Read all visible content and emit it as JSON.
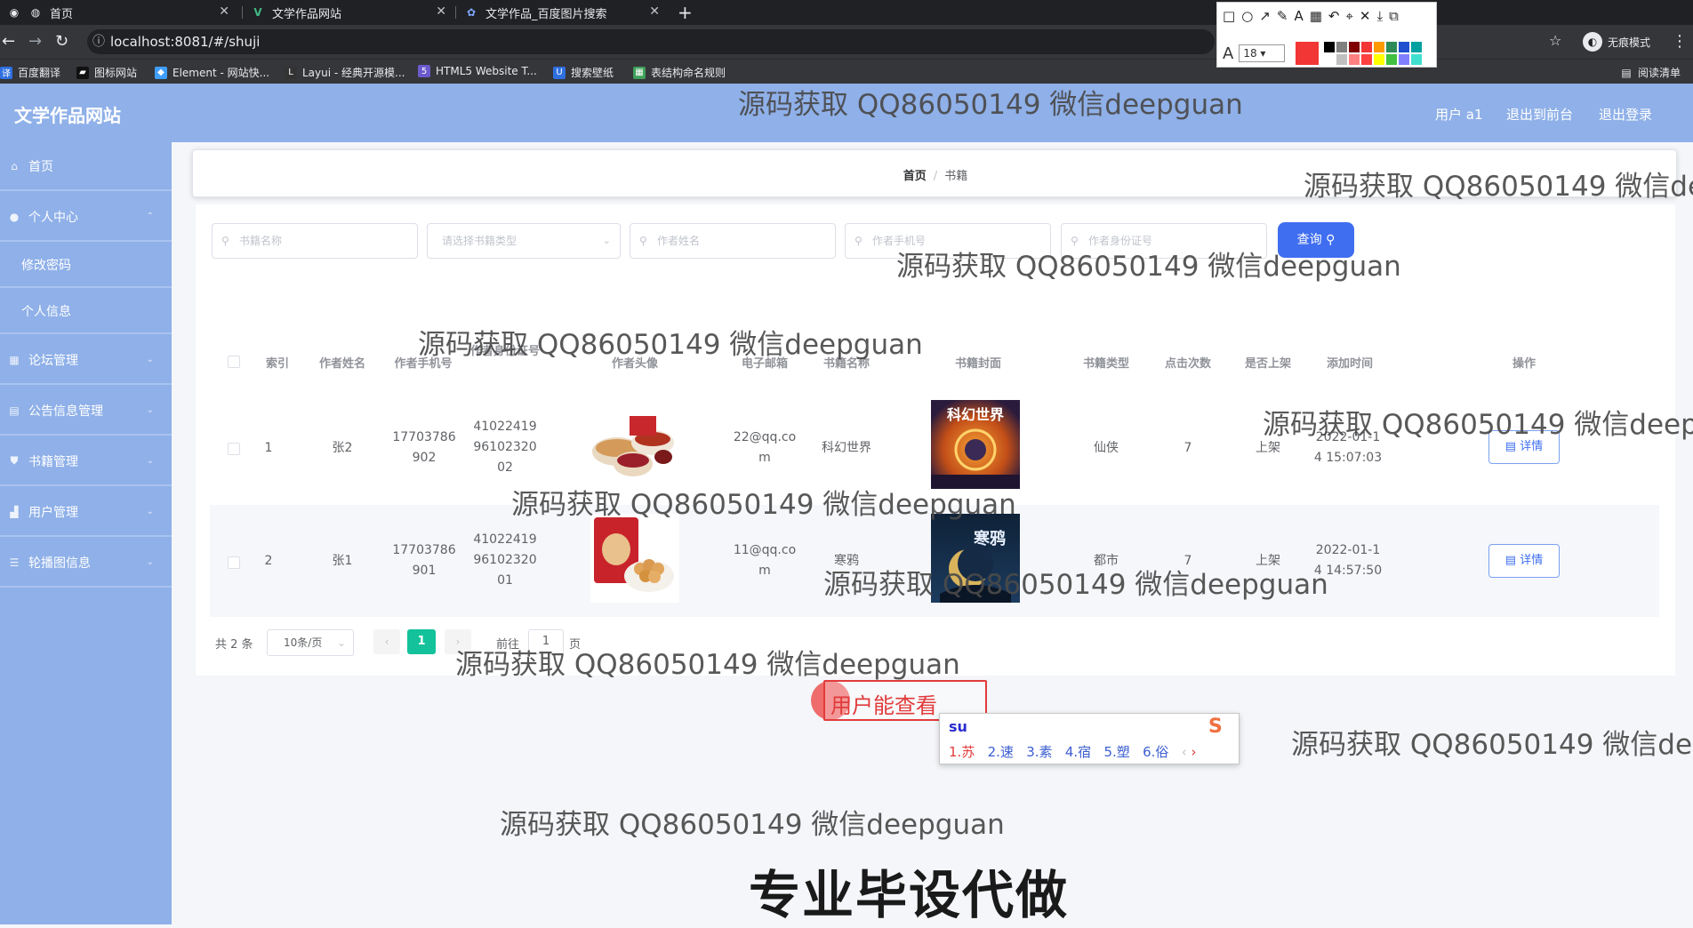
{
  "browser": {
    "tabs": [
      {
        "title": "首页"
      },
      {
        "title": "文学作品网站"
      },
      {
        "title": "文学作品_百度图片搜索"
      }
    ],
    "url": "localhost:8081/#/shuji",
    "incognito_label": "无痕模式",
    "bookmarks": [
      {
        "label": "百度翻译",
        "color": "#2f6fe0"
      },
      {
        "label": "图标网站",
        "color": "#222222"
      },
      {
        "label": "Element - 网站快...",
        "color": "#409eff"
      },
      {
        "label": "Layui - 经典开源模...",
        "color": "#222222"
      },
      {
        "label": "HTML5 Website T...",
        "color": "#6a5acd"
      },
      {
        "label": "搜索壁纸",
        "color": "#2f6fe0"
      },
      {
        "label": "表结构命名规则",
        "color": "#3ea05a"
      }
    ],
    "reading_list": "阅读清单"
  },
  "annotation_toolbar": {
    "font_size": "18",
    "current_color": "#f23535",
    "palette": [
      "#000000",
      "#808080",
      "#800000",
      "#f23535",
      "#ff9900",
      "#2e8b57",
      "#1e50d0",
      "#00a0a0",
      "#ffffff",
      "#c0c0c0",
      "#ff8080",
      "#ff4040",
      "#ffff00",
      "#40c040",
      "#8080ff",
      "#40e0d0"
    ]
  },
  "header": {
    "title": "文学作品网站",
    "user": "用户 a1",
    "back_to_front": "退出到前台",
    "logout": "退出登录"
  },
  "sidebar": {
    "items": [
      {
        "label": "首页",
        "icon": "home-icon"
      },
      {
        "label": "个人中心",
        "icon": "user-icon"
      },
      {
        "label": "修改密码"
      },
      {
        "label": "个人信息"
      },
      {
        "label": "论坛管理",
        "icon": "grid-icon"
      },
      {
        "label": "公告信息管理",
        "icon": "doc-icon"
      },
      {
        "label": "书籍管理",
        "icon": "shield-icon"
      },
      {
        "label": "用户管理",
        "icon": "chart-icon"
      },
      {
        "label": "轮播图信息",
        "icon": "menu-icon"
      }
    ]
  },
  "breadcrumb": {
    "home": "首页",
    "current": "书籍"
  },
  "search": {
    "book_name_placeholder": "书籍名称",
    "book_type_placeholder": "请选择书籍类型",
    "author_name_placeholder": "作者姓名",
    "author_phone_placeholder": "作者手机号",
    "author_id_placeholder": "作者身份证号",
    "query_button": "查询"
  },
  "table": {
    "columns": [
      "索引",
      "作者姓名",
      "作者手机号",
      "作者身份证号",
      "作者头像",
      "电子邮箱",
      "书籍名称",
      "书籍封面",
      "书籍类型",
      "点击次数",
      "是否上架",
      "添加时间",
      "操作"
    ],
    "rows": [
      {
        "index": "1",
        "author": "张2",
        "phone": "17703786902",
        "id_card": "410224199610232002",
        "email": "22@qq.com",
        "book": "科幻世界",
        "cover_title": "科幻世界",
        "type": "仙侠",
        "clicks": "7",
        "listed": "上架",
        "added": "2022-01-14 15:07:03",
        "action": "详情"
      },
      {
        "index": "2",
        "author": "张1",
        "phone": "17703786901",
        "id_card": "410224199610232001",
        "email": "11@qq.com",
        "book": "寒鸦",
        "cover_title": "寒鸦",
        "type": "都市",
        "clicks": "7",
        "listed": "上架",
        "added": "2022-01-14 14:57:50",
        "action": "详情"
      }
    ]
  },
  "pagination": {
    "total": "共 2 条",
    "page_size": "10条/页",
    "current_page": "1",
    "goto_label": "前往",
    "goto_value": "1",
    "page_suffix": "页"
  },
  "overlay": {
    "note_text": "用户能查看",
    "ime_input": "su",
    "ime_candidates": [
      "1.苏",
      "2.速",
      "3.素",
      "4.宿",
      "5.塑",
      "6.俗"
    ]
  },
  "watermarks": {
    "text": "源码获取 QQ86050149 微信deepguan",
    "banner": "专业毕设代做"
  }
}
